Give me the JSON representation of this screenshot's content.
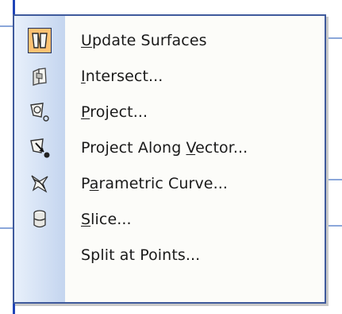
{
  "menu": {
    "items": [
      {
        "id": "update-surfaces",
        "pre": "",
        "mnemonic": "U",
        "post": "pdate Surfaces",
        "icon": "update-surfaces-icon",
        "highlighted": true
      },
      {
        "id": "intersect",
        "pre": "",
        "mnemonic": "I",
        "post": "ntersect...",
        "icon": "intersect-icon",
        "highlighted": false
      },
      {
        "id": "project",
        "pre": "",
        "mnemonic": "P",
        "post": "roject...",
        "icon": "project-icon",
        "highlighted": false
      },
      {
        "id": "project-along-vector",
        "pre": "Project Along ",
        "mnemonic": "V",
        "post": "ector...",
        "icon": "project-along-vector-icon",
        "highlighted": false
      },
      {
        "id": "parametric-curve",
        "pre": "P",
        "mnemonic": "a",
        "post": "rametric Curve...",
        "icon": "parametric-curve-icon",
        "highlighted": false
      },
      {
        "id": "slice",
        "pre": "",
        "mnemonic": "S",
        "post": "lice...",
        "icon": "slice-icon",
        "highlighted": false
      },
      {
        "id": "split-at-points",
        "pre": "Split at Points...",
        "mnemonic": "",
        "post": "",
        "icon": "",
        "highlighted": false
      }
    ]
  },
  "colors": {
    "highlight_fill": "#ffc272",
    "highlight_border": "#20305e",
    "menu_border": "#3f5a9c",
    "icon_column_light": "#e8f0fb",
    "icon_column_dark": "#c4d5ef"
  }
}
